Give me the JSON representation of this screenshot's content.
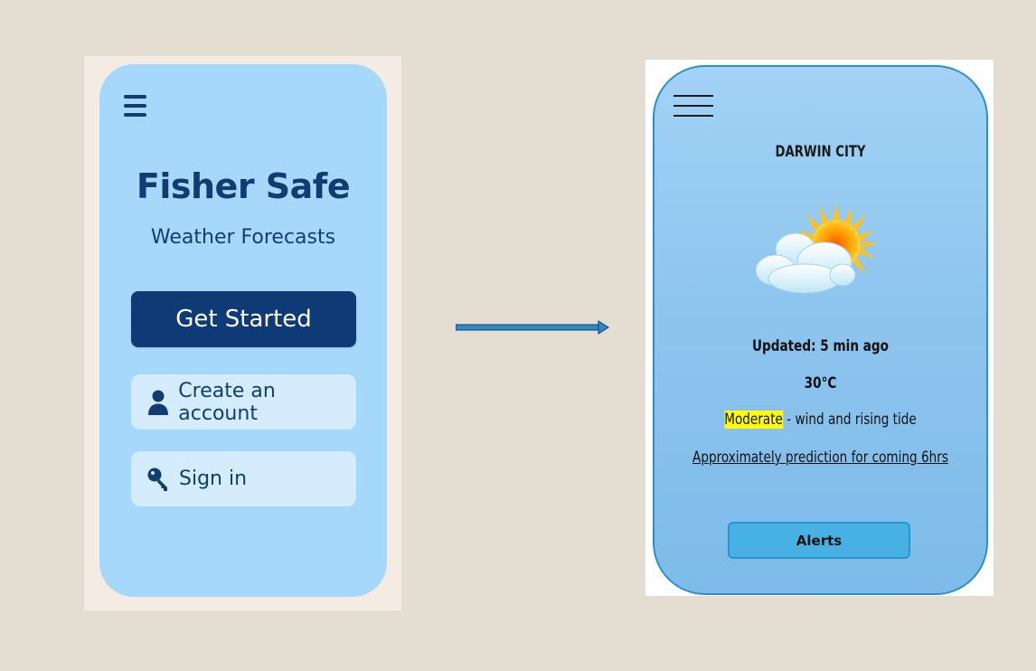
{
  "landing": {
    "title": "Fisher Safe",
    "subtitle": "Weather Forecasts",
    "get_started_label": "Get Started",
    "create_account_label": "Create an account",
    "sign_in_label": "Sign in",
    "colors": {
      "screen": "#a6d8fb",
      "primary": "#0e3b76",
      "soft_button": "#d4ecfc"
    }
  },
  "forecast": {
    "city": "DARWIN CITY",
    "updated": "Updated: 5 min ago",
    "temperature": "30°C",
    "condition_highlight": "Moderate",
    "condition_rest": " - wind and rising tide",
    "prediction": "Approximately prediction for coming 6hrs",
    "alerts_label": "Alerts",
    "weather_icon": "partly-sunny-icon",
    "colors": {
      "screen": "#8ec5ee",
      "alerts_button": "#48b1e3",
      "highlight": "#ffff00"
    }
  }
}
